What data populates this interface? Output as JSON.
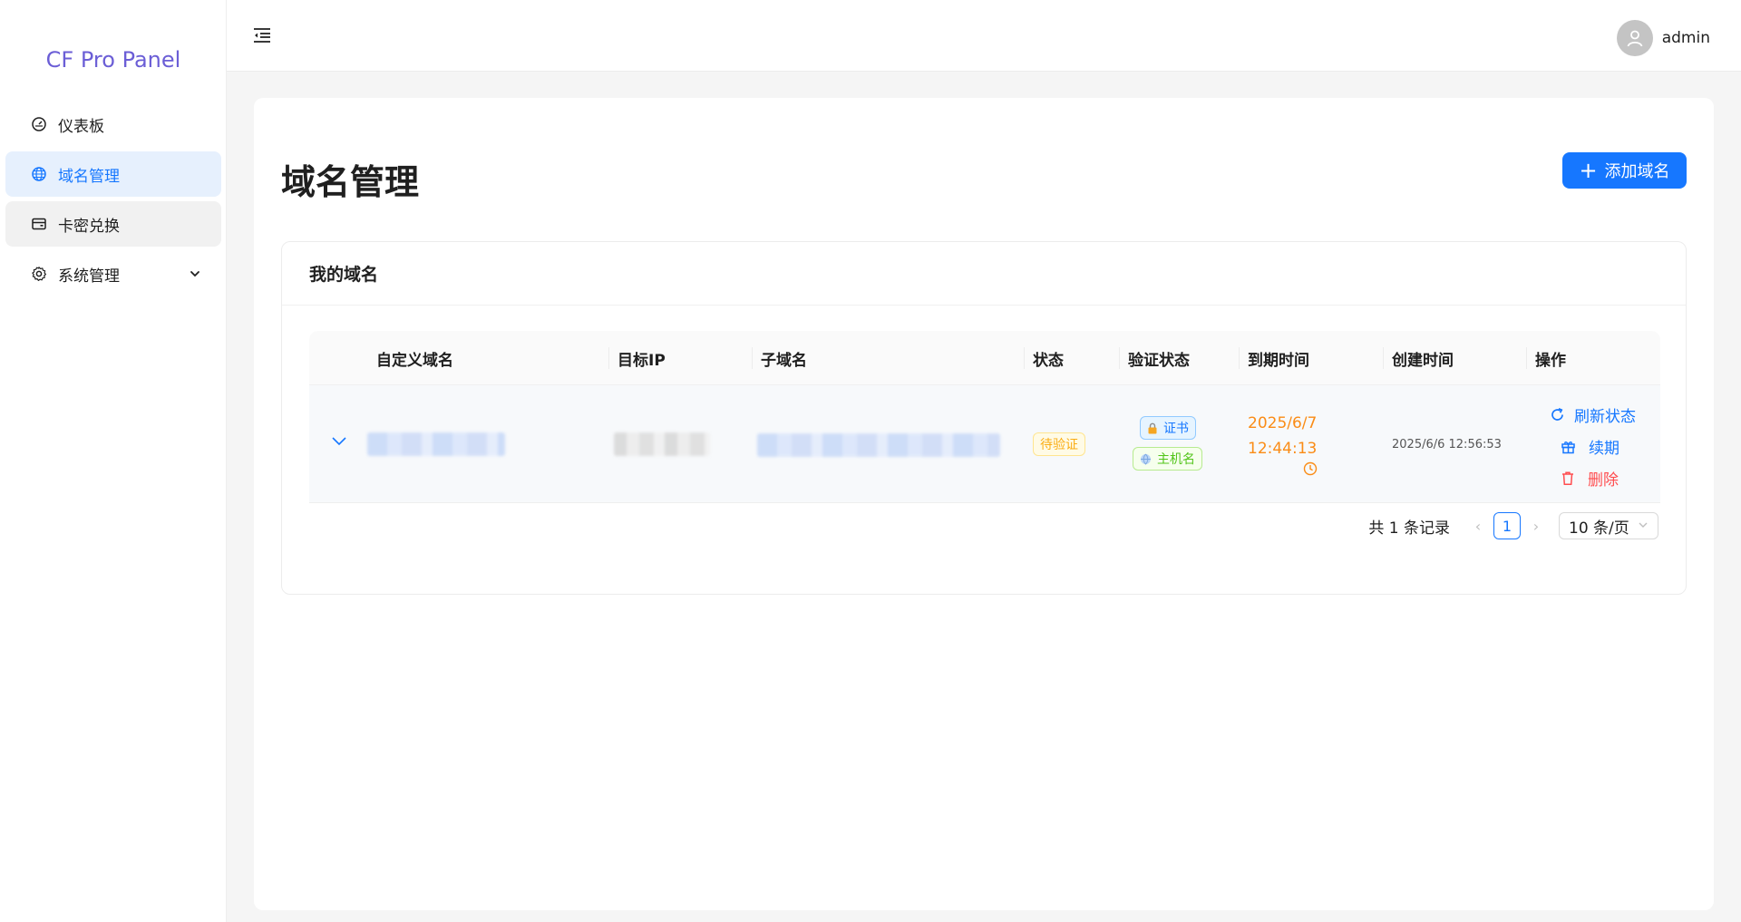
{
  "sidebar": {
    "brand": "CF Pro Panel",
    "items": [
      {
        "label": "仪表板",
        "icon": "dashboard-icon"
      },
      {
        "label": "域名管理",
        "icon": "globe-icon"
      },
      {
        "label": "卡密兑换",
        "icon": "wallet-icon"
      },
      {
        "label": "系统管理",
        "icon": "gear-icon"
      }
    ]
  },
  "header": {
    "username": "admin"
  },
  "main": {
    "title": "域名管理",
    "add_button": "添加域名",
    "card_title": "我的域名",
    "table": {
      "columns": [
        "自定义域名",
        "目标IP",
        "子域名",
        "状态",
        "验证状态",
        "到期时间",
        "创建时间",
        "操作"
      ],
      "rows": [
        {
          "status": "待验证",
          "verify_cert": "证书",
          "verify_host": "主机名",
          "expire_date": "2025/6/7",
          "expire_time": "12:44:13",
          "created": "2025/6/6 12:56:53",
          "actions": {
            "refresh": "刷新状态",
            "renew": "续期",
            "delete": "删除"
          }
        }
      ]
    },
    "pagination": {
      "total": "共 1 条记录",
      "current_page": "1",
      "page_size": "10 条/页"
    }
  },
  "colors": {
    "primary": "#1677ff",
    "brand": "#6b5ed6",
    "warning": "#faad14",
    "expire": "#fa8c16",
    "danger": "#ff4d4f",
    "success": "#52c41a"
  }
}
